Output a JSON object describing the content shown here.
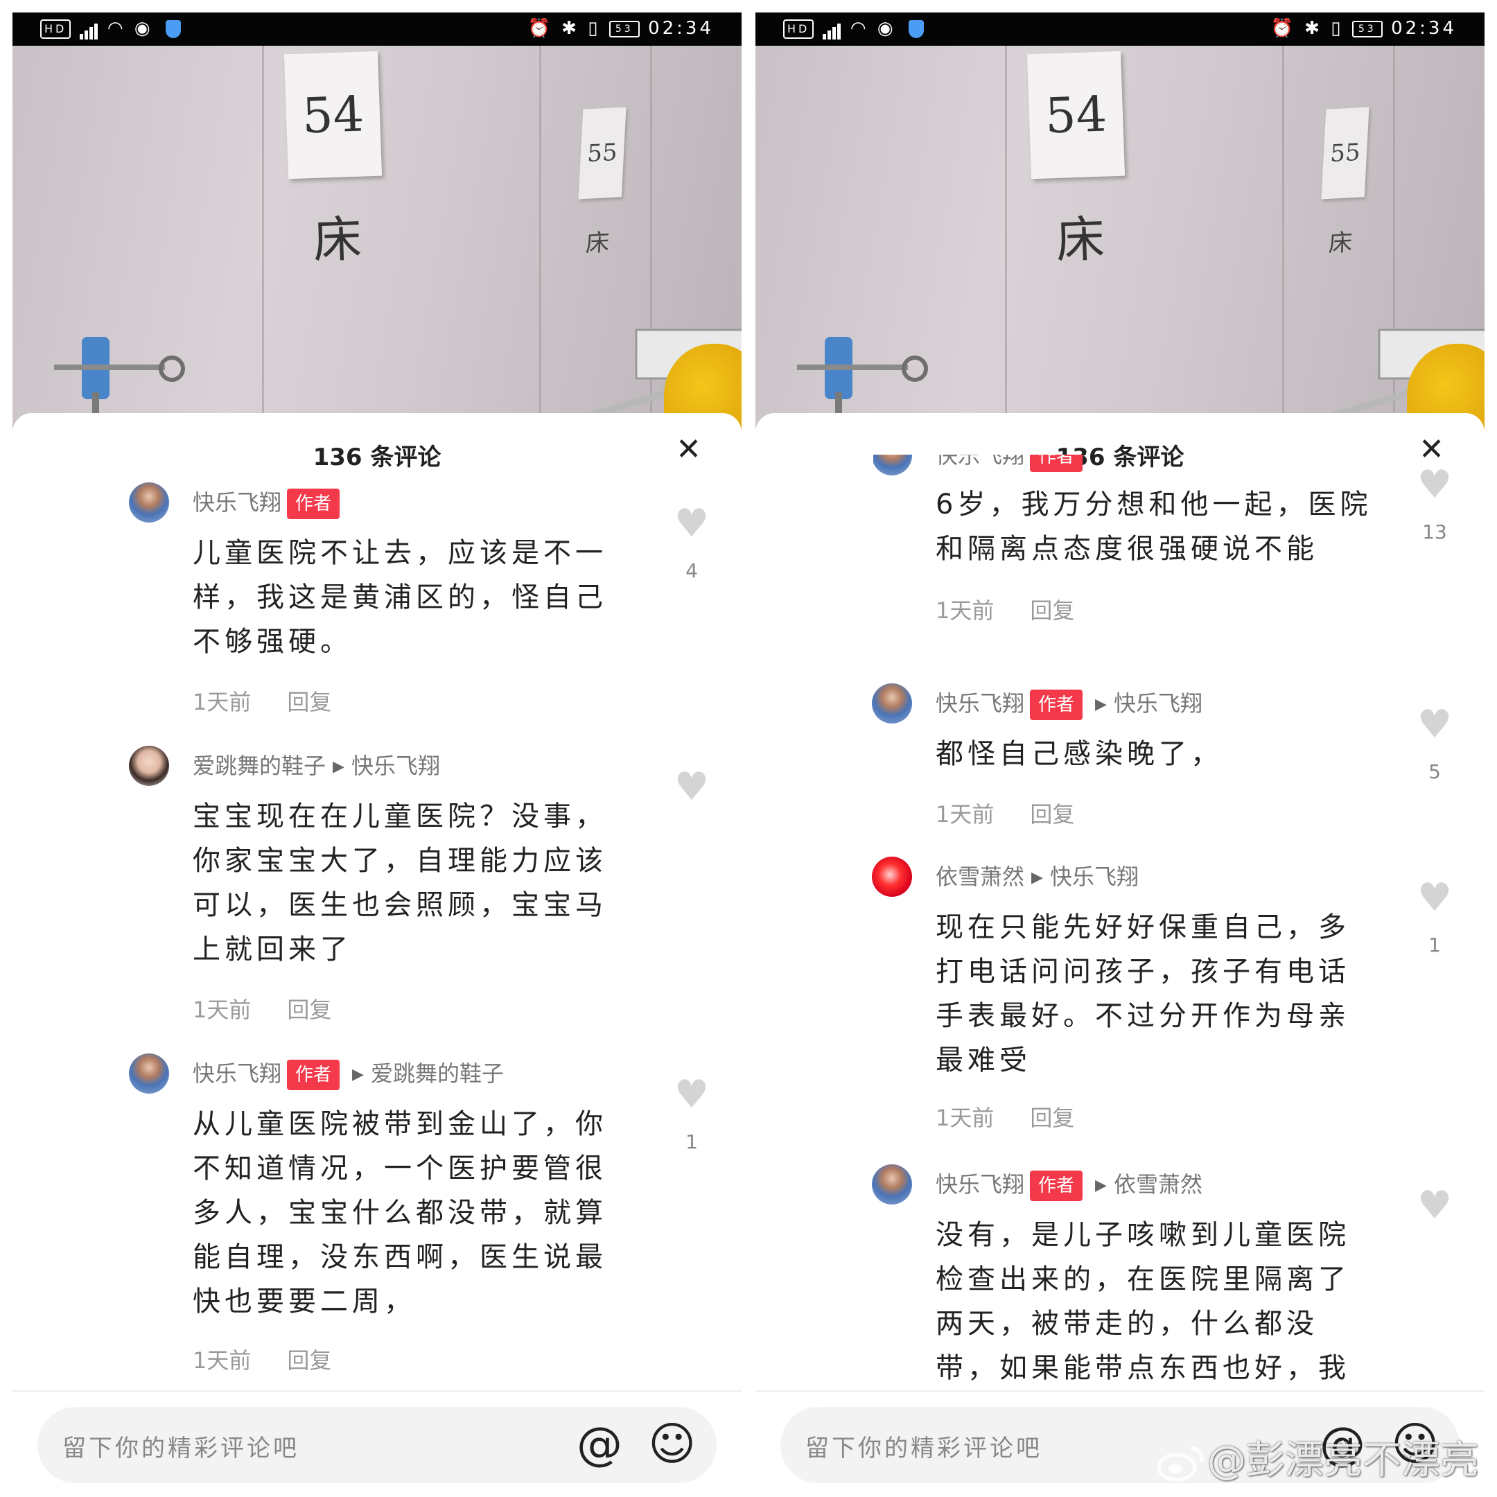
{
  "status_bar": {
    "time": "02:34",
    "battery": "53"
  },
  "photo": {
    "sign_main": "54床",
    "sign_side": "55床"
  },
  "panels": [
    {
      "title": "136 条评论",
      "comments": [
        {
          "user": "快乐飞翔",
          "tag": "作者",
          "reply_to": "",
          "text": "儿童医院不让去，应该是不一样，我这是黄浦区的，怪自己不够强硬。",
          "time": "1天前",
          "reply": "回复",
          "likes": "4"
        },
        {
          "user": "爱跳舞的鞋子",
          "tag": "",
          "reply_to": "快乐飞翔",
          "text": "宝宝现在在儿童医院？没事，你家宝宝大了，自理能力应该可以，医生也会照顾，宝宝马上就回来了",
          "time": "1天前",
          "reply": "回复",
          "likes": ""
        },
        {
          "user": "快乐飞翔",
          "tag": "作者",
          "reply_to": "爱跳舞的鞋子",
          "text": "从儿童医院被带到金山了，你不知道情况，一个医护要管很多人，宝宝什么都没带，就算能自理，没东西啊，医生说最快也要要二周，",
          "time": "1天前",
          "reply": "回复",
          "likes": "1"
        }
      ],
      "input_placeholder": "留下你的精彩评论吧"
    },
    {
      "title": "136 条评论",
      "comments": [
        {
          "user": "快乐飞翔",
          "tag": "作者",
          "reply_to": "",
          "text": "6岁，我万分想和他一起，医院和隔离点态度很强硬说不能",
          "time": "1天前",
          "reply": "回复",
          "likes": "13"
        },
        {
          "user": "快乐飞翔",
          "tag": "作者",
          "reply_to": "快乐飞翔",
          "text": "都怪自己感染晚了，",
          "time": "1天前",
          "reply": "回复",
          "likes": "5"
        },
        {
          "user": "依雪萧然",
          "tag": "",
          "reply_to": "快乐飞翔",
          "text": "现在只能先好好保重自己，多打电话问问孩子，孩子有电话手表最好。不过分开作为母亲最难受",
          "time": "1天前",
          "reply": "回复",
          "likes": "1"
        },
        {
          "user": "快乐飞翔",
          "tag": "作者",
          "reply_to": "依雪萧然",
          "text": "没有，是儿子咳嗽到儿童医院检查出来的，在医院里隔离了两天，被带走的，什么都没带，如果能带点东西也好，我",
          "time": "",
          "reply": "",
          "likes": ""
        }
      ],
      "input_placeholder": "留下你的精彩评论吧"
    }
  ],
  "watermark": "@彭漂亮不漂亮"
}
